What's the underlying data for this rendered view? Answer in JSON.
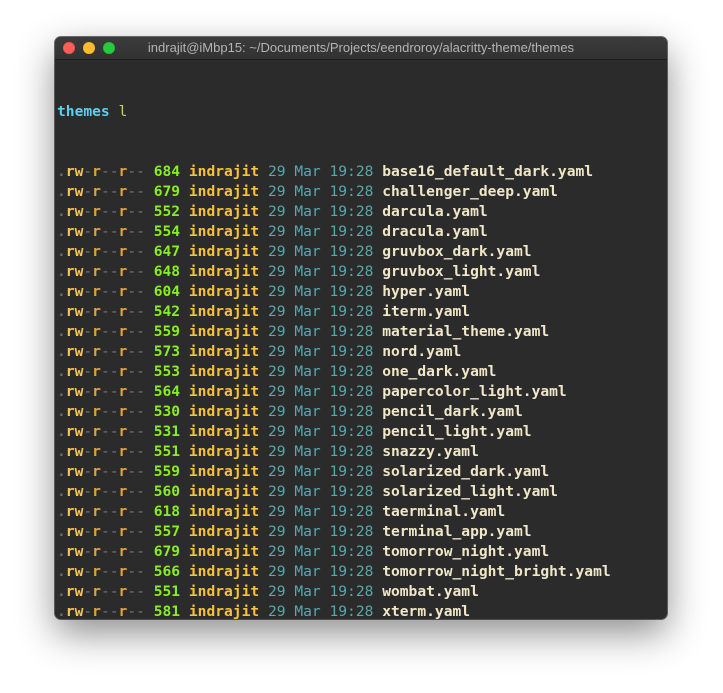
{
  "window": {
    "title": "indrajit@iMbp15: ~/Documents/Projects/eendroroy/alacritty-theme/themes"
  },
  "prompt": {
    "dir": "themes",
    "command": "l"
  },
  "listing": {
    "perms_prefix": ".",
    "perms_owner": "rw",
    "perms_mid1": "-",
    "perms_group": "r",
    "perms_mid2": "--",
    "perms_other": "r",
    "perms_tail": "--",
    "user": "indrajit",
    "date": "29 Mar 19:28"
  },
  "files": [
    {
      "size": "684",
      "name": "base16_default_dark.yaml"
    },
    {
      "size": "679",
      "name": "challenger_deep.yaml"
    },
    {
      "size": "552",
      "name": "darcula.yaml"
    },
    {
      "size": "554",
      "name": "dracula.yaml"
    },
    {
      "size": "647",
      "name": "gruvbox_dark.yaml"
    },
    {
      "size": "648",
      "name": "gruvbox_light.yaml"
    },
    {
      "size": "604",
      "name": "hyper.yaml"
    },
    {
      "size": "542",
      "name": "iterm.yaml"
    },
    {
      "size": "559",
      "name": "material_theme.yaml"
    },
    {
      "size": "573",
      "name": "nord.yaml"
    },
    {
      "size": "553",
      "name": "one_dark.yaml"
    },
    {
      "size": "564",
      "name": "papercolor_light.yaml"
    },
    {
      "size": "530",
      "name": "pencil_dark.yaml"
    },
    {
      "size": "531",
      "name": "pencil_light.yaml"
    },
    {
      "size": "551",
      "name": "snazzy.yaml"
    },
    {
      "size": "559",
      "name": "solarized_dark.yaml"
    },
    {
      "size": "560",
      "name": "solarized_light.yaml"
    },
    {
      "size": "618",
      "name": "taerminal.yaml"
    },
    {
      "size": "557",
      "name": "terminal_app.yaml"
    },
    {
      "size": "679",
      "name": "tomorrow_night.yaml"
    },
    {
      "size": "566",
      "name": "tomorrow_night_bright.yaml"
    },
    {
      "size": "551",
      "name": "wombat.yaml"
    },
    {
      "size": "581",
      "name": "xterm.yaml"
    }
  ],
  "colors": {
    "background": "#2b2b2b",
    "prompt_dir": "#5ad1f0",
    "size": "#88ee22",
    "user": "#f8c238",
    "date": "#56a9ad",
    "filename": "#f0e6c8",
    "cursor": "#efdcb5"
  }
}
